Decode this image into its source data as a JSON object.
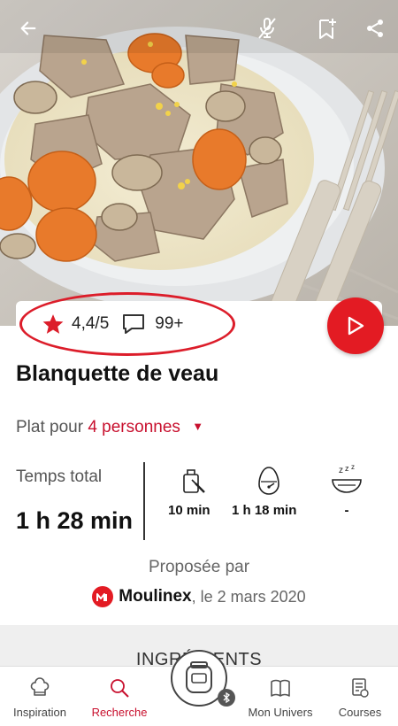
{
  "topbar": {
    "icons": [
      "back-arrow-icon",
      "mic-off-icon",
      "bookmark-add-icon",
      "share-icon"
    ]
  },
  "recipe": {
    "rating": "4,4/5",
    "comments_count": "99+",
    "title": "Blanquette de veau",
    "servings_prefix": "Plat pour",
    "servings_value": "4 personnes",
    "time_total_label": "Temps total",
    "time_total_value": "1 h 28 min",
    "steps": [
      {
        "icon": "prep-icon",
        "value": "10 min"
      },
      {
        "icon": "timer-icon",
        "value": "1 h 18 min"
      },
      {
        "icon": "rest-icon",
        "value": "-"
      }
    ],
    "proposed_by_label": "Proposée par",
    "brand": "Moulinex",
    "date_text": ", le 2 mars 2020",
    "section_label": "INGRÉDIENTS"
  },
  "nav": {
    "items": [
      {
        "label": "Inspiration",
        "icon": "chef-hat-icon"
      },
      {
        "label": "Recherche",
        "icon": "search-icon"
      },
      {
        "label": "Mon Univers",
        "icon": "book-icon"
      },
      {
        "label": "Courses",
        "icon": "shopping-list-icon"
      }
    ],
    "active": "Recherche"
  },
  "colors": {
    "accent": "#e31b23",
    "accent_text": "#c8102e"
  }
}
